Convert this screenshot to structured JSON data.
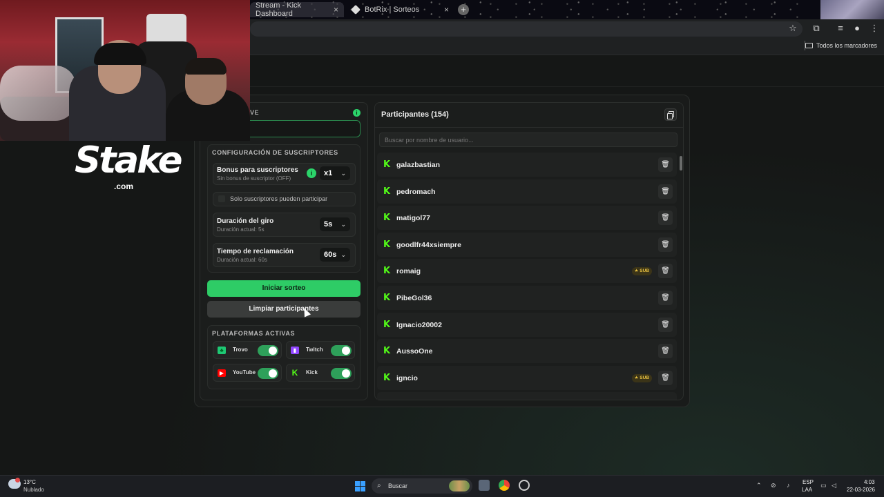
{
  "browser": {
    "tabs": [
      {
        "label": "Stream - Kick Dashboard"
      },
      {
        "label": "BotRix | Sorteos"
      }
    ],
    "bookmarks_folder": "Todos los marcadores"
  },
  "overlay": {
    "logo_word": "Stake",
    "logo_suffix": ".com"
  },
  "settings": {
    "key_label": "VE",
    "info_mark": "i",
    "subscribers_section_title": "CONFIGURACIÓN DE SUSCRIPTORES",
    "bonus_title": "Bonus para suscriptores",
    "bonus_sub": "Sin bonus de suscriptor (OFF)",
    "bonus_value": "x1",
    "subs_only_label": "Solo suscriptores pueden participar",
    "spin_title": "Duración del giro",
    "spin_sub": "Duración actual: 5s",
    "spin_value": "5s",
    "claim_title": "Tiempo de reclamación",
    "claim_sub": "Duración actual: 60s",
    "claim_value": "60s",
    "start_button": "Iniciar sorteo",
    "clear_button": "Limpiar participantes",
    "platforms_title": "PLATAFORMAS ACTIVAS",
    "platforms": [
      {
        "name": "Trovo",
        "enabled": true,
        "color": "#1ec874"
      },
      {
        "name": "Twitch",
        "enabled": true,
        "color": "#9146ff"
      },
      {
        "name": "YouTube",
        "enabled": true,
        "color": "#ff0000"
      },
      {
        "name": "Kick",
        "enabled": true,
        "color": "#53fc18"
      }
    ]
  },
  "participants": {
    "title": "Participantes (154)",
    "search_placeholder": "Buscar por nombre de usuario...",
    "sub_badge": "SUB",
    "items": [
      {
        "name": "galazbastian",
        "sub": false
      },
      {
        "name": "pedromach",
        "sub": false
      },
      {
        "name": "matigol77",
        "sub": false
      },
      {
        "name": "goodlfr44xsiempre",
        "sub": false
      },
      {
        "name": "romaig",
        "sub": true
      },
      {
        "name": "PibeGol36",
        "sub": false
      },
      {
        "name": "Ignacio20002",
        "sub": false
      },
      {
        "name": "AussoOne",
        "sub": false
      },
      {
        "name": "igncio",
        "sub": true
      }
    ]
  },
  "taskbar": {
    "temp": "13°C",
    "weather": "Nublado",
    "search_label": "Buscar",
    "lang_top": "ESP",
    "lang_bottom": "LAA",
    "time": "4:03",
    "date": "22-03-2026"
  },
  "colors": {
    "accent": "#2ecc66",
    "kick": "#53fc18",
    "sub_gold": "#e8c140"
  }
}
